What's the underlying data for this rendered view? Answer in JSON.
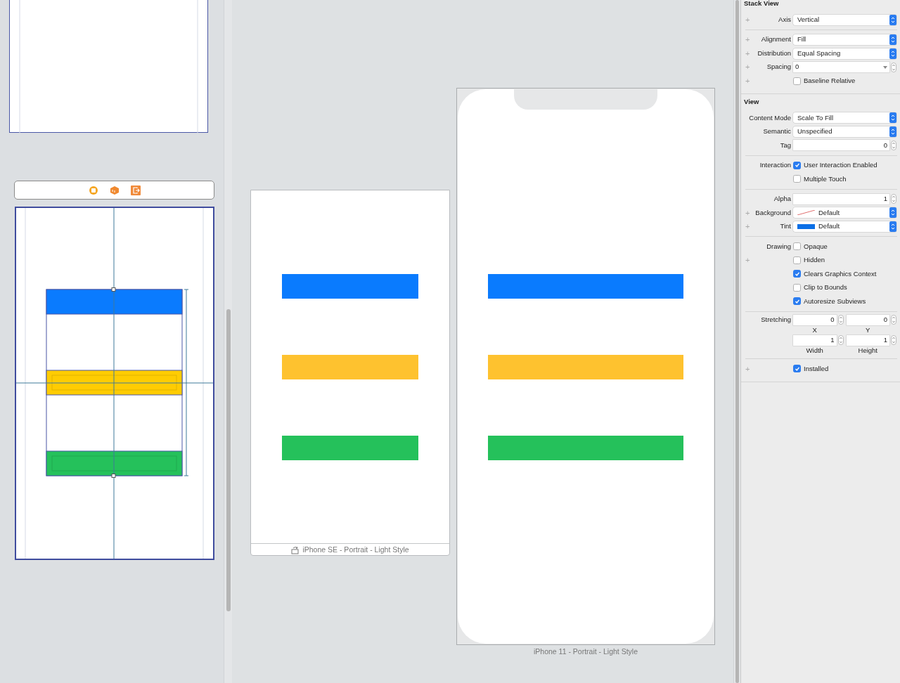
{
  "scene": {
    "bars": [
      {
        "color": "#0a7bfe"
      },
      {
        "color": "#ffcc02"
      },
      {
        "color": "#25c15b"
      }
    ]
  },
  "previews": [
    {
      "kind": "compact",
      "label": "iPhone SE - Portrait - Light Style",
      "bars": [
        {
          "color": "#0a7bfe"
        },
        {
          "color": "#fec22f"
        },
        {
          "color": "#25c15b"
        }
      ]
    },
    {
      "kind": "notch",
      "label": "iPhone 11 - Portrait - Light Style",
      "bars": [
        {
          "color": "#0a7bfe"
        },
        {
          "color": "#fec22f"
        },
        {
          "color": "#25c15b"
        }
      ]
    }
  ],
  "inspector": {
    "sections": [
      {
        "title": "Stack View",
        "rows": [
          {
            "kind": "popup",
            "plus": "+",
            "label": "Axis",
            "value": "Vertical"
          },
          {
            "kind": "divider"
          },
          {
            "kind": "popup",
            "plus": "+",
            "label": "Alignment",
            "value": "Fill"
          },
          {
            "kind": "popup",
            "plus": "+",
            "label": "Distribution",
            "value": "Equal Spacing"
          },
          {
            "kind": "combo",
            "plus": "+",
            "label": "Spacing",
            "value": "0"
          },
          {
            "kind": "check",
            "plus": "+",
            "text": "Baseline Relative",
            "checked": false
          }
        ]
      },
      {
        "title": "View",
        "rows": [
          {
            "kind": "popup",
            "label": "Content Mode",
            "value": "Scale To Fill"
          },
          {
            "kind": "popup",
            "label": "Semantic",
            "value": "Unspecified"
          },
          {
            "kind": "number",
            "label": "Tag",
            "value": "0"
          },
          {
            "kind": "divider"
          },
          {
            "kind": "check",
            "label": "Interaction",
            "text": "User Interaction Enabled",
            "checked": true
          },
          {
            "kind": "check",
            "text": "Multiple Touch",
            "checked": false
          },
          {
            "kind": "divider"
          },
          {
            "kind": "number",
            "label": "Alpha",
            "value": "1"
          },
          {
            "kind": "color",
            "plus": "+",
            "label": "Background",
            "value": "Default"
          },
          {
            "kind": "color",
            "plus": "+",
            "label": "Tint",
            "value": "Default",
            "color": "#0b6fe6"
          },
          {
            "kind": "divider"
          },
          {
            "kind": "check",
            "label": "Drawing",
            "text": "Opaque",
            "checked": false
          },
          {
            "kind": "check",
            "plus": "+",
            "text": "Hidden",
            "checked": false
          },
          {
            "kind": "check",
            "text": "Clears Graphics Context",
            "checked": true
          },
          {
            "kind": "check",
            "text": "Clip to Bounds",
            "checked": false
          },
          {
            "kind": "check",
            "text": "Autoresize Subviews",
            "checked": true
          },
          {
            "kind": "divider"
          },
          {
            "kind": "pair",
            "label": "Stretching",
            "fields": [
              {
                "value": "0",
                "caption": "X"
              },
              {
                "value": "0",
                "caption": "Y"
              }
            ]
          },
          {
            "kind": "pair",
            "fields": [
              {
                "value": "1",
                "caption": "Width"
              },
              {
                "value": "1",
                "caption": "Height"
              }
            ]
          },
          {
            "kind": "divider"
          },
          {
            "kind": "check",
            "plus": "+",
            "text": "Installed",
            "checked": true
          }
        ]
      }
    ]
  }
}
